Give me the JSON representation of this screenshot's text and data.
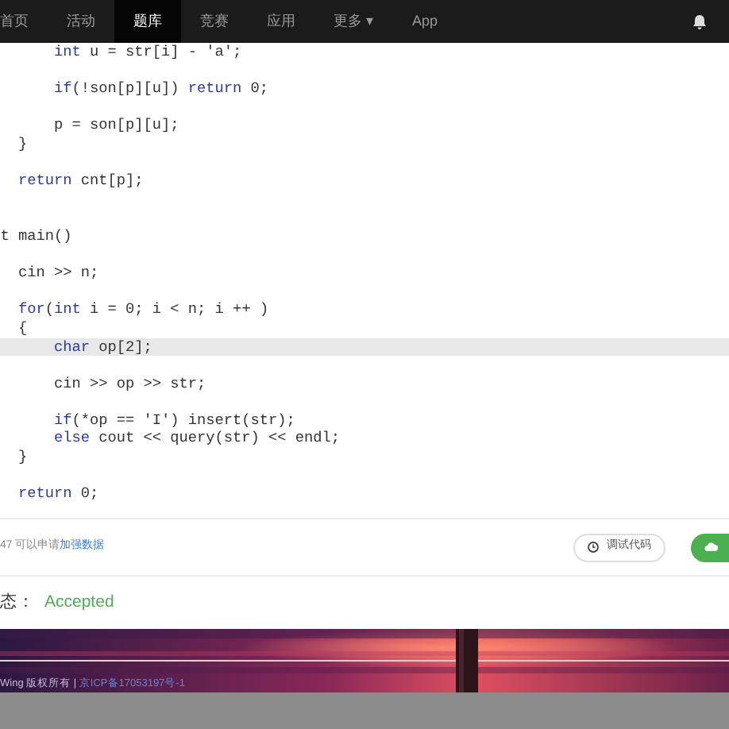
{
  "navbar": {
    "items": [
      {
        "label": "首页",
        "selected": false
      },
      {
        "label": "活动",
        "selected": false
      },
      {
        "label": "题库",
        "selected": true
      },
      {
        "label": "竞赛",
        "selected": false
      },
      {
        "label": "应用",
        "selected": false
      },
      {
        "label": "更多 ▾",
        "selected": false
      },
      {
        "label": "App",
        "selected": false
      }
    ]
  },
  "code": {
    "lines": [
      {
        "highlighted": false,
        "parts": [
          {
            "kind": "keyword",
            "text": "        int"
          },
          {
            "kind": "plain",
            "text": " u = str[i] - 'a';"
          }
        ]
      },
      {
        "highlighted": false
      },
      {
        "highlighted": false,
        "parts": [
          {
            "kind": "keyword",
            "text": "        if"
          },
          {
            "kind": "plain",
            "text": "(!son[p][u]) "
          },
          {
            "kind": "keyword",
            "text": "return"
          },
          {
            "kind": "plain",
            "text": " 0;"
          }
        ]
      },
      {
        "highlighted": false
      },
      {
        "highlighted": false,
        "parts": [
          {
            "kind": "plain",
            "text": "        p = son[p][u];"
          }
        ]
      },
      {
        "highlighted": false,
        "parts": [
          {
            "kind": "plain",
            "text": "    }"
          }
        ]
      },
      {
        "highlighted": false
      },
      {
        "highlighted": false,
        "parts": [
          {
            "kind": "keyword",
            "text": "    return"
          },
          {
            "kind": "plain",
            "text": " cnt[p];"
          }
        ]
      },
      {
        "highlighted": false
      },
      {
        "highlighted": false
      },
      {
        "highlighted": false,
        "parts": [
          {
            "kind": "plain",
            "text": "  t main()"
          }
        ]
      },
      {
        "highlighted": false
      },
      {
        "highlighted": false,
        "parts": [
          {
            "kind": "plain",
            "text": "    cin >> n;"
          }
        ]
      },
      {
        "highlighted": false
      },
      {
        "highlighted": false,
        "parts": [
          {
            "kind": "keyword",
            "text": "    for"
          },
          {
            "kind": "plain",
            "text": "("
          },
          {
            "kind": "keyword",
            "text": "int"
          },
          {
            "kind": "plain",
            "text": " i = 0; i < n; i ++ )"
          }
        ]
      },
      {
        "highlighted": false,
        "parts": [
          {
            "kind": "plain",
            "text": "    {"
          }
        ]
      },
      {
        "highlighted": true,
        "parts": [
          {
            "kind": "keyword",
            "text": "        char"
          },
          {
            "kind": "plain",
            "text": " op[2];"
          }
        ]
      },
      {
        "highlighted": false
      },
      {
        "highlighted": false,
        "parts": [
          {
            "kind": "plain",
            "text": "        cin >> op >> str;"
          }
        ]
      },
      {
        "highlighted": false
      },
      {
        "highlighted": false,
        "parts": [
          {
            "kind": "keyword",
            "text": "        if"
          },
          {
            "kind": "plain",
            "text": "(*op == 'I') insert(str);"
          }
        ]
      },
      {
        "highlighted": false,
        "parts": [
          {
            "kind": "keyword",
            "text": "        else"
          },
          {
            "kind": "plain",
            "text": " cout << query(str) << endl;"
          }
        ]
      },
      {
        "highlighted": false,
        "parts": [
          {
            "kind": "plain",
            "text": "    }"
          }
        ]
      },
      {
        "highlighted": false
      },
      {
        "highlighted": false,
        "parts": [
          {
            "kind": "keyword",
            "text": "    return"
          },
          {
            "kind": "plain",
            "text": " 0;"
          }
        ]
      }
    ]
  },
  "hint": {
    "text": "47 可以申请",
    "link": "加强数据"
  },
  "debug_button": {
    "label": "调试代码"
  },
  "status": {
    "label": "态：",
    "value": "Accepted"
  },
  "footer": {
    "copyright": "Wing 版权所有 |",
    "icp": "京ICP备17053197号-1"
  }
}
